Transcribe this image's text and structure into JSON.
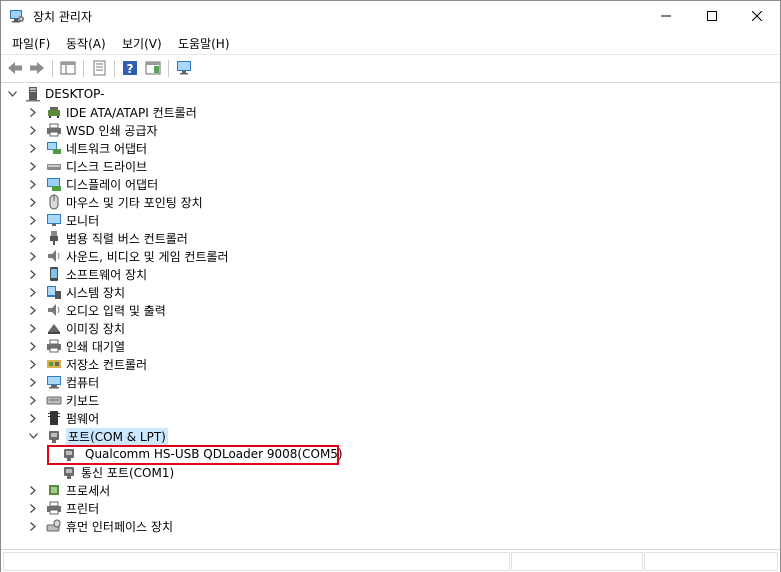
{
  "window": {
    "title": "장치 관리자"
  },
  "menu": [
    {
      "label": "파일(F)"
    },
    {
      "label": "동작(A)"
    },
    {
      "label": "보기(V)"
    },
    {
      "label": "도움말(H)"
    }
  ],
  "tree": {
    "root": "DESKTOP-",
    "categories": [
      {
        "label": "IDE ATA/ATAPI 컨트롤러",
        "icon": "ide-controller-icon"
      },
      {
        "label": "WSD 인쇄 공급자",
        "icon": "printer-icon"
      },
      {
        "label": "네트워크 어댑터",
        "icon": "network-adapter-icon"
      },
      {
        "label": "디스크 드라이브",
        "icon": "disk-drive-icon"
      },
      {
        "label": "디스플레이 어댑터",
        "icon": "display-adapter-icon"
      },
      {
        "label": "마우스 및 기타 포인팅 장치",
        "icon": "mouse-icon"
      },
      {
        "label": "모니터",
        "icon": "monitor-icon"
      },
      {
        "label": "범용 직렬 버스 컨트롤러",
        "icon": "usb-icon"
      },
      {
        "label": "사운드, 비디오 및 게임 컨트롤러",
        "icon": "speaker-icon"
      },
      {
        "label": "소프트웨어 장치",
        "icon": "software-device-icon"
      },
      {
        "label": "시스템 장치",
        "icon": "system-device-icon"
      },
      {
        "label": "오디오 입력 및 출력",
        "icon": "speaker-icon"
      },
      {
        "label": "이미징 장치",
        "icon": "camera-icon"
      },
      {
        "label": "인쇄 대기열",
        "icon": "printer-icon"
      },
      {
        "label": "저장소 컨트롤러",
        "icon": "storage-controller-icon"
      },
      {
        "label": "컴퓨터",
        "icon": "computer-icon"
      },
      {
        "label": "키보드",
        "icon": "keyboard-icon"
      },
      {
        "label": "펌웨어",
        "icon": "firmware-icon"
      }
    ],
    "ports": {
      "label": "포트(COM & LPT)",
      "children": [
        {
          "label": "Qualcomm HS-USB QDLoader 9008(COM5)"
        },
        {
          "label": "통신 포트(COM1)"
        }
      ]
    },
    "after": [
      {
        "label": "프로세서",
        "icon": "processor-icon"
      },
      {
        "label": "프린터",
        "icon": "printer-icon"
      },
      {
        "label": "휴먼 인터페이스 장치",
        "icon": "hid-icon"
      }
    ]
  },
  "colors": {
    "highlight": "#e0001a",
    "selection": "#cce8ff"
  }
}
